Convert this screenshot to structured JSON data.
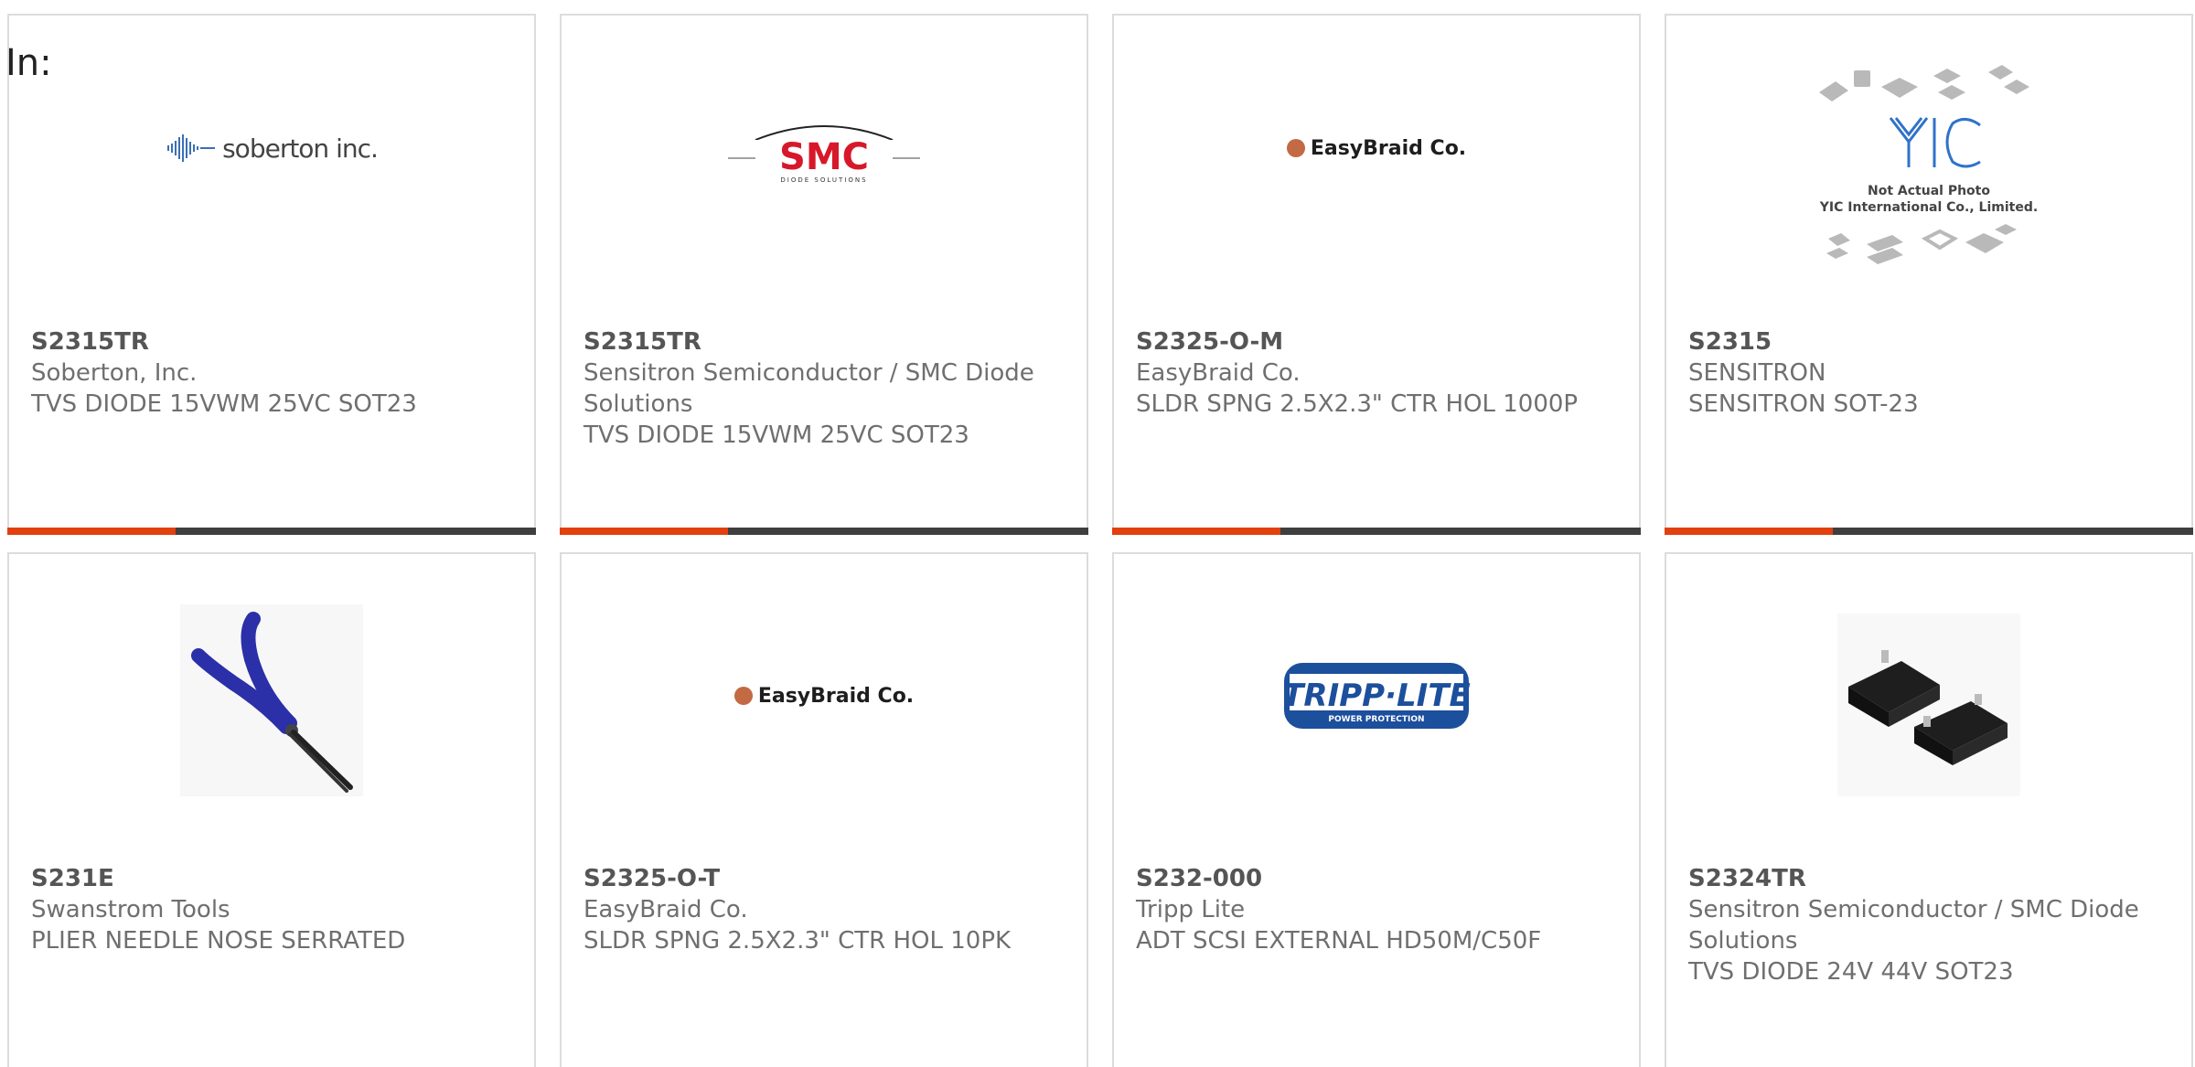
{
  "header": {
    "in_label": "In:"
  },
  "colors": {
    "accent_orange": "#e2400f",
    "accent_dark": "#3f3f3f",
    "card_border": "#dcdcdc"
  },
  "products": [
    {
      "part_number": "S2315TR",
      "manufacturer": "Soberton, Inc.",
      "description": "TVS DIODE 15VWM 25VC SOT23",
      "image": {
        "icon": "soberton-logo",
        "brand_text": "soberton inc."
      }
    },
    {
      "part_number": "S2315TR",
      "manufacturer": "Sensitron Semiconductor / SMC Diode Solutions",
      "description": "TVS DIODE 15VWM 25VC SOT23",
      "image": {
        "icon": "smc-logo",
        "brand_text": "SMC",
        "tagline": "DIODE SOLUTIONS"
      }
    },
    {
      "part_number": "S2325-O-M",
      "manufacturer": "EasyBraid Co.",
      "description": "SLDR SPNG 2.5X2.3\" CTR HOL 1000P",
      "image": {
        "icon": "easybraid-logo",
        "brand_text": "EasyBraid Co."
      }
    },
    {
      "part_number": "S2315",
      "manufacturer": "SENSITRON",
      "description": "SENSITRON SOT-23",
      "image": {
        "icon": "yic-placeholder-photo",
        "brand_text": "YIC",
        "caption_line1": "Not Actual Photo",
        "caption_line2": "YIC International Co., Limited."
      }
    },
    {
      "part_number": "S231E",
      "manufacturer": "Swanstrom Tools",
      "description": "PLIER NEEDLE NOSE SERRATED",
      "image": {
        "icon": "needle-nose-plier-photo"
      }
    },
    {
      "part_number": "S2325-O-T",
      "manufacturer": "EasyBraid Co.",
      "description": "SLDR SPNG 2.5X2.3\" CTR HOL 10PK",
      "image": {
        "icon": "easybraid-logo",
        "brand_text": "EasyBraid Co."
      }
    },
    {
      "part_number": "S232-000",
      "manufacturer": "Tripp Lite",
      "description": "ADT SCSI EXTERNAL HD50M/C50F",
      "image": {
        "icon": "tripp-lite-logo",
        "brand_text": "TRIPP·LITE",
        "tagline": "POWER PROTECTION"
      }
    },
    {
      "part_number": "S2324TR",
      "manufacturer": "Sensitron Semiconductor / SMC Diode Solutions",
      "description": "TVS DIODE 24V 44V SOT23",
      "image": {
        "icon": "sot23-package-photo"
      }
    }
  ]
}
